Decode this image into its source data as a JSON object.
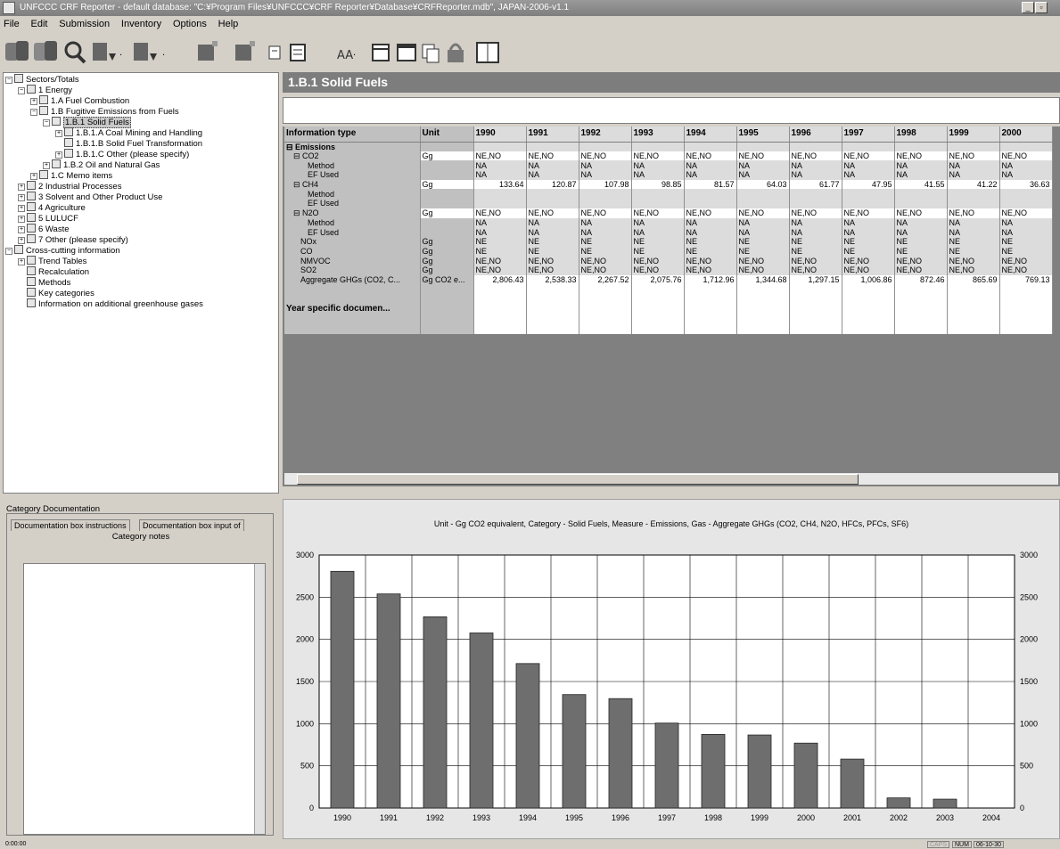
{
  "window": {
    "title": "UNFCCC CRF Reporter - default database: \"C:¥Program Files¥UNFCCC¥CRF Reporter¥Database¥CRFReporter.mdb\", JAPAN-2006-v1.1",
    "minimize": "_",
    "maximize": "▫"
  },
  "menu": [
    "File",
    "Edit",
    "Submission",
    "Inventory",
    "Options",
    "Help"
  ],
  "toolbar": {
    "icons": [
      "database-icon",
      "database-multi-icon",
      "search-icon",
      "import-icon",
      "export-icon",
      "add-item-icon",
      "remove-item-icon",
      "notes-icon",
      "report-icon",
      "text-icon",
      "calendar-icon",
      "window-icon",
      "copy-icon",
      "lock-icon",
      "help-book-icon"
    ]
  },
  "tree": {
    "items": [
      {
        "label": "Sectors/Totals",
        "level": 0,
        "exp": "−"
      },
      {
        "label": "1 Energy",
        "level": 1,
        "exp": "−"
      },
      {
        "label": "1.A Fuel Combustion",
        "level": 2,
        "exp": "+"
      },
      {
        "label": "1.B Fugitive Emissions from Fuels",
        "level": 2,
        "exp": "−"
      },
      {
        "label": "1.B.1 Solid Fuels",
        "level": 3,
        "exp": "−",
        "selected": true
      },
      {
        "label": "1.B.1.A Coal Mining and Handling",
        "level": 4,
        "exp": "+"
      },
      {
        "label": "1.B.1.B Solid Fuel Transformation",
        "level": 4,
        "exp": ""
      },
      {
        "label": "1.B.1.C Other (please specify)",
        "level": 4,
        "exp": "+"
      },
      {
        "label": "1.B.2 Oil and Natural Gas",
        "level": 3,
        "exp": "+"
      },
      {
        "label": "1.C Memo items",
        "level": 2,
        "exp": "+"
      },
      {
        "label": "2 Industrial Processes",
        "level": 1,
        "exp": "+"
      },
      {
        "label": "3 Solvent and Other Product Use",
        "level": 1,
        "exp": "+"
      },
      {
        "label": "4 Agriculture",
        "level": 1,
        "exp": "+"
      },
      {
        "label": "5 LULUCF",
        "level": 1,
        "exp": "+"
      },
      {
        "label": "6 Waste",
        "level": 1,
        "exp": "+"
      },
      {
        "label": "7 Other (please specify)",
        "level": 1,
        "exp": "+"
      },
      {
        "label": "Cross-cutting information",
        "level": 0,
        "exp": "−"
      },
      {
        "label": "Trend Tables",
        "level": 1,
        "exp": "+"
      },
      {
        "label": "Recalculation",
        "level": 1,
        "exp": ""
      },
      {
        "label": "Methods",
        "level": 1,
        "exp": ""
      },
      {
        "label": "Key categories",
        "level": 1,
        "exp": ""
      },
      {
        "label": "Information on additional greenhouse gases",
        "level": 1,
        "exp": ""
      }
    ]
  },
  "section_title": "1.B.1 Solid Fuels",
  "grid": {
    "col_info": "Information type",
    "col_unit": "Unit",
    "years": [
      "1990",
      "1991",
      "1992",
      "1993",
      "1994",
      "1995",
      "1996",
      "1997",
      "1998",
      "1999",
      "2000"
    ],
    "rows": [
      {
        "label": "⊟ Emissions",
        "indent": 0,
        "bold": true,
        "unit": "",
        "values": [
          "",
          "",
          "",
          "",
          "",
          "",
          "",
          "",
          "",
          "",
          ""
        ],
        "type": "group"
      },
      {
        "label": "⊟ CO2",
        "indent": 1,
        "unit": "Gg",
        "values": [
          "NE,NO",
          "NE,NO",
          "NE,NO",
          "NE,NO",
          "NE,NO",
          "NE,NO",
          "NE,NO",
          "NE,NO",
          "NE,NO",
          "NE,NO",
          "NE,NO"
        ],
        "type": "text"
      },
      {
        "label": "Method",
        "indent": 3,
        "unit": "",
        "values": [
          "NA",
          "NA",
          "NA",
          "NA",
          "NA",
          "NA",
          "NA",
          "NA",
          "NA",
          "NA",
          "NA"
        ],
        "type": "gray"
      },
      {
        "label": "EF Used",
        "indent": 3,
        "unit": "",
        "values": [
          "NA",
          "NA",
          "NA",
          "NA",
          "NA",
          "NA",
          "NA",
          "NA",
          "NA",
          "NA",
          "NA"
        ],
        "type": "gray"
      },
      {
        "label": "⊟ CH4",
        "indent": 1,
        "unit": "Gg",
        "values": [
          "133.64",
          "120.87",
          "107.98",
          "98.85",
          "81.57",
          "64.03",
          "61.77",
          "47.95",
          "41.55",
          "41.22",
          "36.63"
        ],
        "type": "num"
      },
      {
        "label": "Method",
        "indent": 3,
        "unit": "",
        "values": [
          "",
          "",
          "",
          "",
          "",
          "",
          "",
          "",
          "",
          "",
          ""
        ],
        "type": "gray"
      },
      {
        "label": "EF Used",
        "indent": 3,
        "unit": "",
        "values": [
          "",
          "",
          "",
          "",
          "",
          "",
          "",
          "",
          "",
          "",
          ""
        ],
        "type": "gray"
      },
      {
        "label": "⊟ N2O",
        "indent": 1,
        "unit": "Gg",
        "values": [
          "NE,NO",
          "NE,NO",
          "NE,NO",
          "NE,NO",
          "NE,NO",
          "NE,NO",
          "NE,NO",
          "NE,NO",
          "NE,NO",
          "NE,NO",
          "NE,NO"
        ],
        "type": "text"
      },
      {
        "label": "Method",
        "indent": 3,
        "unit": "",
        "values": [
          "NA",
          "NA",
          "NA",
          "NA",
          "NA",
          "NA",
          "NA",
          "NA",
          "NA",
          "NA",
          "NA"
        ],
        "type": "gray"
      },
      {
        "label": "EF Used",
        "indent": 3,
        "unit": "",
        "values": [
          "NA",
          "NA",
          "NA",
          "NA",
          "NA",
          "NA",
          "NA",
          "NA",
          "NA",
          "NA",
          "NA"
        ],
        "type": "gray"
      },
      {
        "label": "NOx",
        "indent": 2,
        "unit": "Gg",
        "values": [
          "NE",
          "NE",
          "NE",
          "NE",
          "NE",
          "NE",
          "NE",
          "NE",
          "NE",
          "NE",
          "NE"
        ],
        "type": "gray"
      },
      {
        "label": "CO",
        "indent": 2,
        "unit": "Gg",
        "values": [
          "NE",
          "NE",
          "NE",
          "NE",
          "NE",
          "NE",
          "NE",
          "NE",
          "NE",
          "NE",
          "NE"
        ],
        "type": "gray"
      },
      {
        "label": "NMVOC",
        "indent": 2,
        "unit": "Gg",
        "values": [
          "NE,NO",
          "NE,NO",
          "NE,NO",
          "NE,NO",
          "NE,NO",
          "NE,NO",
          "NE,NO",
          "NE,NO",
          "NE,NO",
          "NE,NO",
          "NE,NO"
        ],
        "type": "gray"
      },
      {
        "label": "SO2",
        "indent": 2,
        "unit": "Gg",
        "values": [
          "NE,NO",
          "NE,NO",
          "NE,NO",
          "NE,NO",
          "NE,NO",
          "NE,NO",
          "NE,NO",
          "NE,NO",
          "NE,NO",
          "NE,NO",
          "NE,NO"
        ],
        "type": "gray"
      },
      {
        "label": "Aggregate GHGs (CO2, C...",
        "indent": 2,
        "unit": "Gg CO2 e...",
        "values": [
          "2,806.43",
          "2,538.33",
          "2,267.52",
          "2,075.76",
          "1,712.96",
          "1,344.68",
          "1,297.15",
          "1,006.86",
          "872.46",
          "865.69",
          "769.13"
        ],
        "type": "num"
      },
      {
        "label": "Year specific documen...",
        "indent": 0,
        "bold": true,
        "unit": "",
        "values": [
          "",
          "",
          "",
          "",
          "",
          "",
          "",
          "",
          "",
          "",
          ""
        ],
        "type": "year"
      }
    ]
  },
  "doc": {
    "title": "Category Documentation",
    "tab1": "Documentation box instructions",
    "tab2": "Documentation box input of",
    "notes_label": "Category notes"
  },
  "chart_data": {
    "type": "bar",
    "title": "Unit - Gg CO2 equivalent, Category - Solid Fuels, Measure - Emissions, Gas - Aggregate GHGs (CO2, CH4, N2O, HFCs, PFCs, SF6)",
    "categories": [
      "1990",
      "1991",
      "1992",
      "1993",
      "1994",
      "1995",
      "1996",
      "1997",
      "1998",
      "1999",
      "2000",
      "2001",
      "2002",
      "2003",
      "2004"
    ],
    "values": [
      2806.43,
      2538.33,
      2267.52,
      2075.76,
      1712.96,
      1344.68,
      1297.15,
      1006.86,
      872.46,
      865.69,
      769.13,
      580,
      120,
      105,
      0
    ],
    "ylim": [
      0,
      3000
    ],
    "yticks": [
      "0",
      "500",
      "1000",
      "1500",
      "2000",
      "2500",
      "3000"
    ],
    "grid": true,
    "bar_color": "#6e6e6e"
  },
  "status": {
    "left": "0:00:00",
    "caps": "CAPS",
    "num": "NUM",
    "time": "06-10-30"
  }
}
